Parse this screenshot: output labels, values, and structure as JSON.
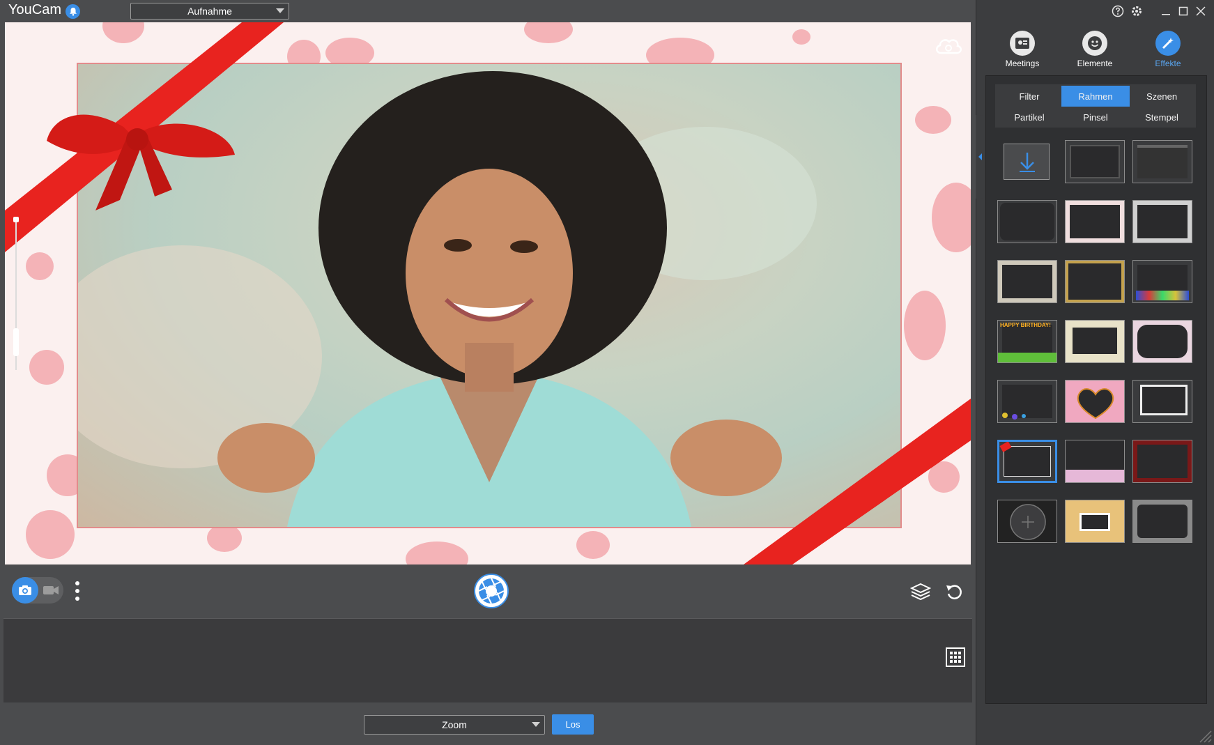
{
  "app": {
    "title": "YouCam"
  },
  "header": {
    "mode_select": "Aufnahme"
  },
  "nav": {
    "meetings": "Meetings",
    "elements": "Elemente",
    "effects": "Effekte"
  },
  "tabs": [
    {
      "label": "Filter"
    },
    {
      "label": "Rahmen"
    },
    {
      "label": "Szenen"
    },
    {
      "label": "Partikel"
    },
    {
      "label": "Pinsel"
    },
    {
      "label": "Stempel"
    }
  ],
  "active_tab": "Rahmen",
  "frames": {
    "thumbs": [
      {
        "name": "download",
        "caption": ""
      },
      {
        "name": "frame-plain",
        "caption": ""
      },
      {
        "name": "frame-dark-top",
        "caption": ""
      },
      {
        "name": "frame-rounded",
        "caption": ""
      },
      {
        "name": "frame-floral",
        "caption": ""
      },
      {
        "name": "frame-torn",
        "caption": ""
      },
      {
        "name": "frame-sketch",
        "caption": ""
      },
      {
        "name": "frame-gold",
        "caption": ""
      },
      {
        "name": "frame-gifts",
        "caption": ""
      },
      {
        "name": "frame-birthday",
        "caption": "HAPPY BIRTHDAY!"
      },
      {
        "name": "frame-paper",
        "caption": ""
      },
      {
        "name": "frame-cloud",
        "caption": ""
      },
      {
        "name": "frame-bubbles",
        "caption": ""
      },
      {
        "name": "frame-heart",
        "caption": ""
      },
      {
        "name": "frame-polaroid",
        "caption": ""
      },
      {
        "name": "frame-ribbon",
        "caption": ""
      },
      {
        "name": "frame-blossom",
        "caption": ""
      },
      {
        "name": "frame-roses",
        "caption": ""
      },
      {
        "name": "frame-target",
        "caption": ""
      },
      {
        "name": "frame-beach",
        "caption": ""
      },
      {
        "name": "frame-vintage",
        "caption": ""
      }
    ],
    "selected_index": 15
  },
  "footer": {
    "zoom_select": "Zoom",
    "go_button": "Los"
  },
  "colors": {
    "accent": "#3a8ee6",
    "background": "#4b4c4e",
    "panel": "#3c3d3f",
    "ribbon": "#e8231f",
    "dots": "#f2a8ad"
  },
  "icons": {
    "bell": "bell-icon",
    "help": "help-icon",
    "settings": "gear-icon",
    "minimize": "minimize-icon",
    "maximize": "maximize-icon",
    "close": "close-icon",
    "camera": "camera-icon",
    "video": "video-icon",
    "shutter": "shutter-icon",
    "layers": "layers-icon",
    "reset": "rotate-icon",
    "grid": "grid-icon",
    "cloud": "cloud-camera-icon"
  }
}
